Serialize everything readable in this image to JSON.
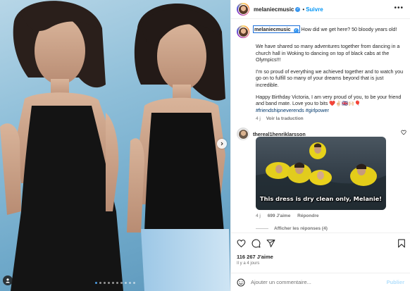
{
  "post": {
    "username": "melaniecmusic",
    "follow_label": "Suivre",
    "more_label": "•••",
    "carousel": {
      "total_slides": 10,
      "active_index": 0
    }
  },
  "caption": {
    "username": "melaniecmusic",
    "headline": "How did we get here? 50 bloody years old!",
    "paragraphs": [
      "We have shared so many adventures together from dancing in a church hall in Woking to dancing on top of black cabs at the Olympics!!!",
      "I'm so proud of everything we achieved together and to watch you go on to fulfill so many of your dreams beyond that is just incredible.",
      "Happy Birthday Victoria, I am very proud of you, to be your friend and band mate. Love you to bits ❤️✌🏻🇬🇧🙌🏻🎈"
    ],
    "hashtags": "#friendshipneverends #girlpower",
    "time": "4 j",
    "translate_label": "Voir la traduction"
  },
  "comment": {
    "username": "thereal1henriklarsson",
    "gif_caption": "This dress is dry clean only, Melanie!",
    "time": "4 j",
    "likes": "699 J'aime",
    "reply_label": "Répondre",
    "view_replies": "Afficher les réponses (4)"
  },
  "actions": {
    "likes_count": "116 267 J'aime",
    "time_ago": "Il y a 4 jours",
    "comment_placeholder": "Ajouter un commentaire...",
    "publish_label": "Publier"
  },
  "colors": {
    "accent": "#0095f6",
    "verified": "#3897f0",
    "heart": "#ed4956"
  }
}
